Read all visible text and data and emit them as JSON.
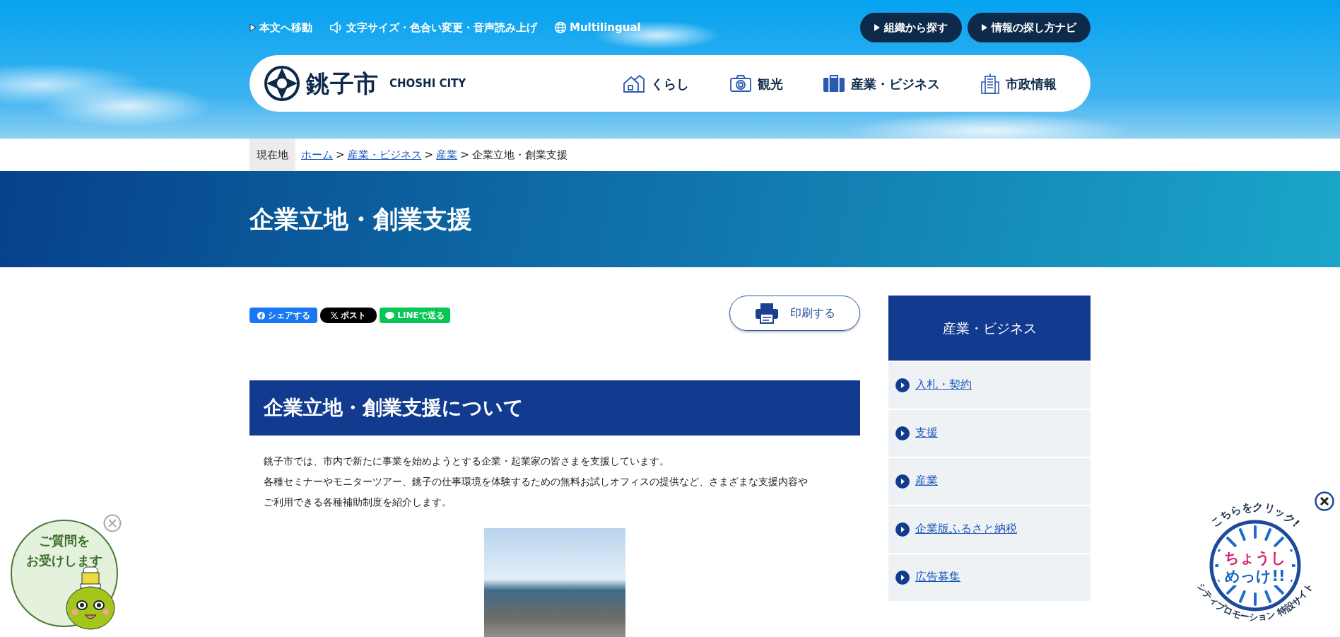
{
  "header": {
    "utility_links": [
      {
        "kind": "skip",
        "label": "本文へ移動"
      },
      {
        "kind": "speaker",
        "label": "文字サイズ・色合い変更・音声読み上げ"
      },
      {
        "kind": "globe",
        "label": "Multilingual"
      }
    ],
    "top_buttons": [
      "組織から探す",
      "情報の探し方ナビ"
    ],
    "logo": {
      "name": "銚子市",
      "subtitle": "CHOSHI CITY"
    },
    "nav": [
      {
        "kind": "house",
        "label": "くらし"
      },
      {
        "kind": "camera",
        "label": "観光"
      },
      {
        "kind": "briefcase",
        "label": "産業・ビジネス"
      },
      {
        "kind": "building",
        "label": "市政情報"
      }
    ]
  },
  "breadcrumb": {
    "label": "現在地",
    "links": [
      "ホーム",
      "産業・ビジネス",
      "産業"
    ],
    "separators": [
      ">",
      ">",
      ">"
    ],
    "current": "企業立地・創業支援"
  },
  "page_title": "企業立地・創業支援",
  "share_buttons": [
    {
      "kind": "facebook",
      "label": "シェアする"
    },
    {
      "kind": "x",
      "label": "ポスト"
    },
    {
      "kind": "line",
      "label": "LINEで送る"
    }
  ],
  "print_button": "印刷する",
  "section": {
    "heading": "企業立地・創業支援について",
    "lines": [
      "銚子市では、市内で新たに事業を始めようとする企業・起業家の皆さまを支援しています。",
      "各種セミナーやモニターツアー、銚子の仕事環境を体験するための無料お試しオフィスの提供など、さまざまな支援内容や",
      "ご利用できる各種補助制度を紹介します。"
    ]
  },
  "sidebar": {
    "title": "産業・ビジネス",
    "items": [
      "入札・契約",
      "支援",
      "産業",
      "企業版ふるさと納税",
      "広告募集"
    ]
  },
  "chat_widget": {
    "lines": [
      "ご質問を",
      "お受けします"
    ]
  },
  "promo_badge": {
    "top": "こちらをクリック!",
    "logo_lines": [
      "ちょうし",
      "めっけ!!"
    ],
    "bottom": "シティプロモーション 特設サイト"
  }
}
